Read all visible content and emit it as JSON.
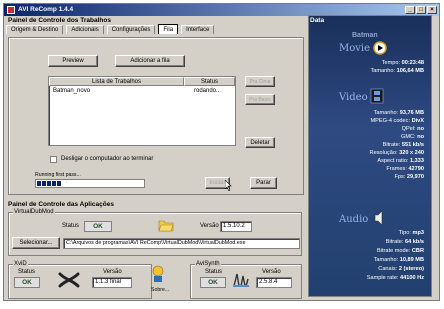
{
  "window": {
    "title": "AVI ReComp 1.4.4",
    "minimize": "_",
    "maximize": "□",
    "close": "×"
  },
  "jobs_panel": {
    "title": "Painel de Controle dos Trabalhos",
    "tabs": [
      "Origem & Destino",
      "Adicionais",
      "Configurações",
      "Fila",
      "Interface"
    ],
    "active_tab": "Fila",
    "preview_button": "Preview",
    "add_queue_button": "Adicionar a fila",
    "list": {
      "columns": [
        "Lista de Trabalhos",
        "Status"
      ],
      "rows": [
        {
          "name": "Batman_novo",
          "status": "rodando.."
        }
      ]
    },
    "side_buttons": [
      "Pra Cima",
      "Pra Baixo",
      "Deletar"
    ],
    "shutdown_checkbox": "Desligar o computador ao terminar",
    "progress_label": "Running first pass...",
    "progress_percent": 25,
    "start_button": "Iniciar",
    "stop_button": "Parar"
  },
  "apps_panel": {
    "title": "Painel de Controle das Aplicações",
    "vdm_group": "VirtualDubMod",
    "status_label": "Status",
    "status_value": "OK",
    "version_label": "Versão",
    "vdm_version": "1.5.10.2",
    "select_button": "Selecionar...",
    "vdm_path": "C:\\Arquivos de programas\\AVI ReComp\\VirtualDubMod\\VirtualDubMod.exe",
    "xvid_group": "XviD",
    "xvid_version": "1.1.3 final",
    "about_label": "Sobre...",
    "avisynth_group": "AviSynth",
    "avisynth_version": "2.5.8.4"
  },
  "data_panel": {
    "title": "Data",
    "name": "Batman",
    "movie_head": "Movie",
    "movie": [
      {
        "k": "Tempo:",
        "v": "00:23:48"
      },
      {
        "k": "Tamanho:",
        "v": "106,64 MB"
      }
    ],
    "video_head": "Video",
    "video": [
      {
        "k": "Tamanho:",
        "v": "93,76 MB"
      },
      {
        "k": "MPEG-4 codec:",
        "v": "DivX"
      },
      {
        "k": "QPel:",
        "v": "no"
      },
      {
        "k": "GMC:",
        "v": "no"
      },
      {
        "k": "Bitrate:",
        "v": "551 kb/s"
      },
      {
        "k": "Resolução:",
        "v": "320 x 240"
      },
      {
        "k": "Aspect ratio:",
        "v": "1,333"
      },
      {
        "k": "Frames:",
        "v": "42790"
      },
      {
        "k": "Fps:",
        "v": "29,970"
      }
    ],
    "audio_head": "Audio",
    "audio": [
      {
        "k": "Tipo:",
        "v": "mp3"
      },
      {
        "k": "Bitrate:",
        "v": "64 kb/s"
      },
      {
        "k": "Bitrate mode:",
        "v": "CBR"
      },
      {
        "k": "Tamanho:",
        "v": "10,89 MB"
      },
      {
        "k": "Canais:",
        "v": "2 (stereo)"
      },
      {
        "k": "Sample rate:",
        "v": "44100 Hz"
      }
    ]
  }
}
